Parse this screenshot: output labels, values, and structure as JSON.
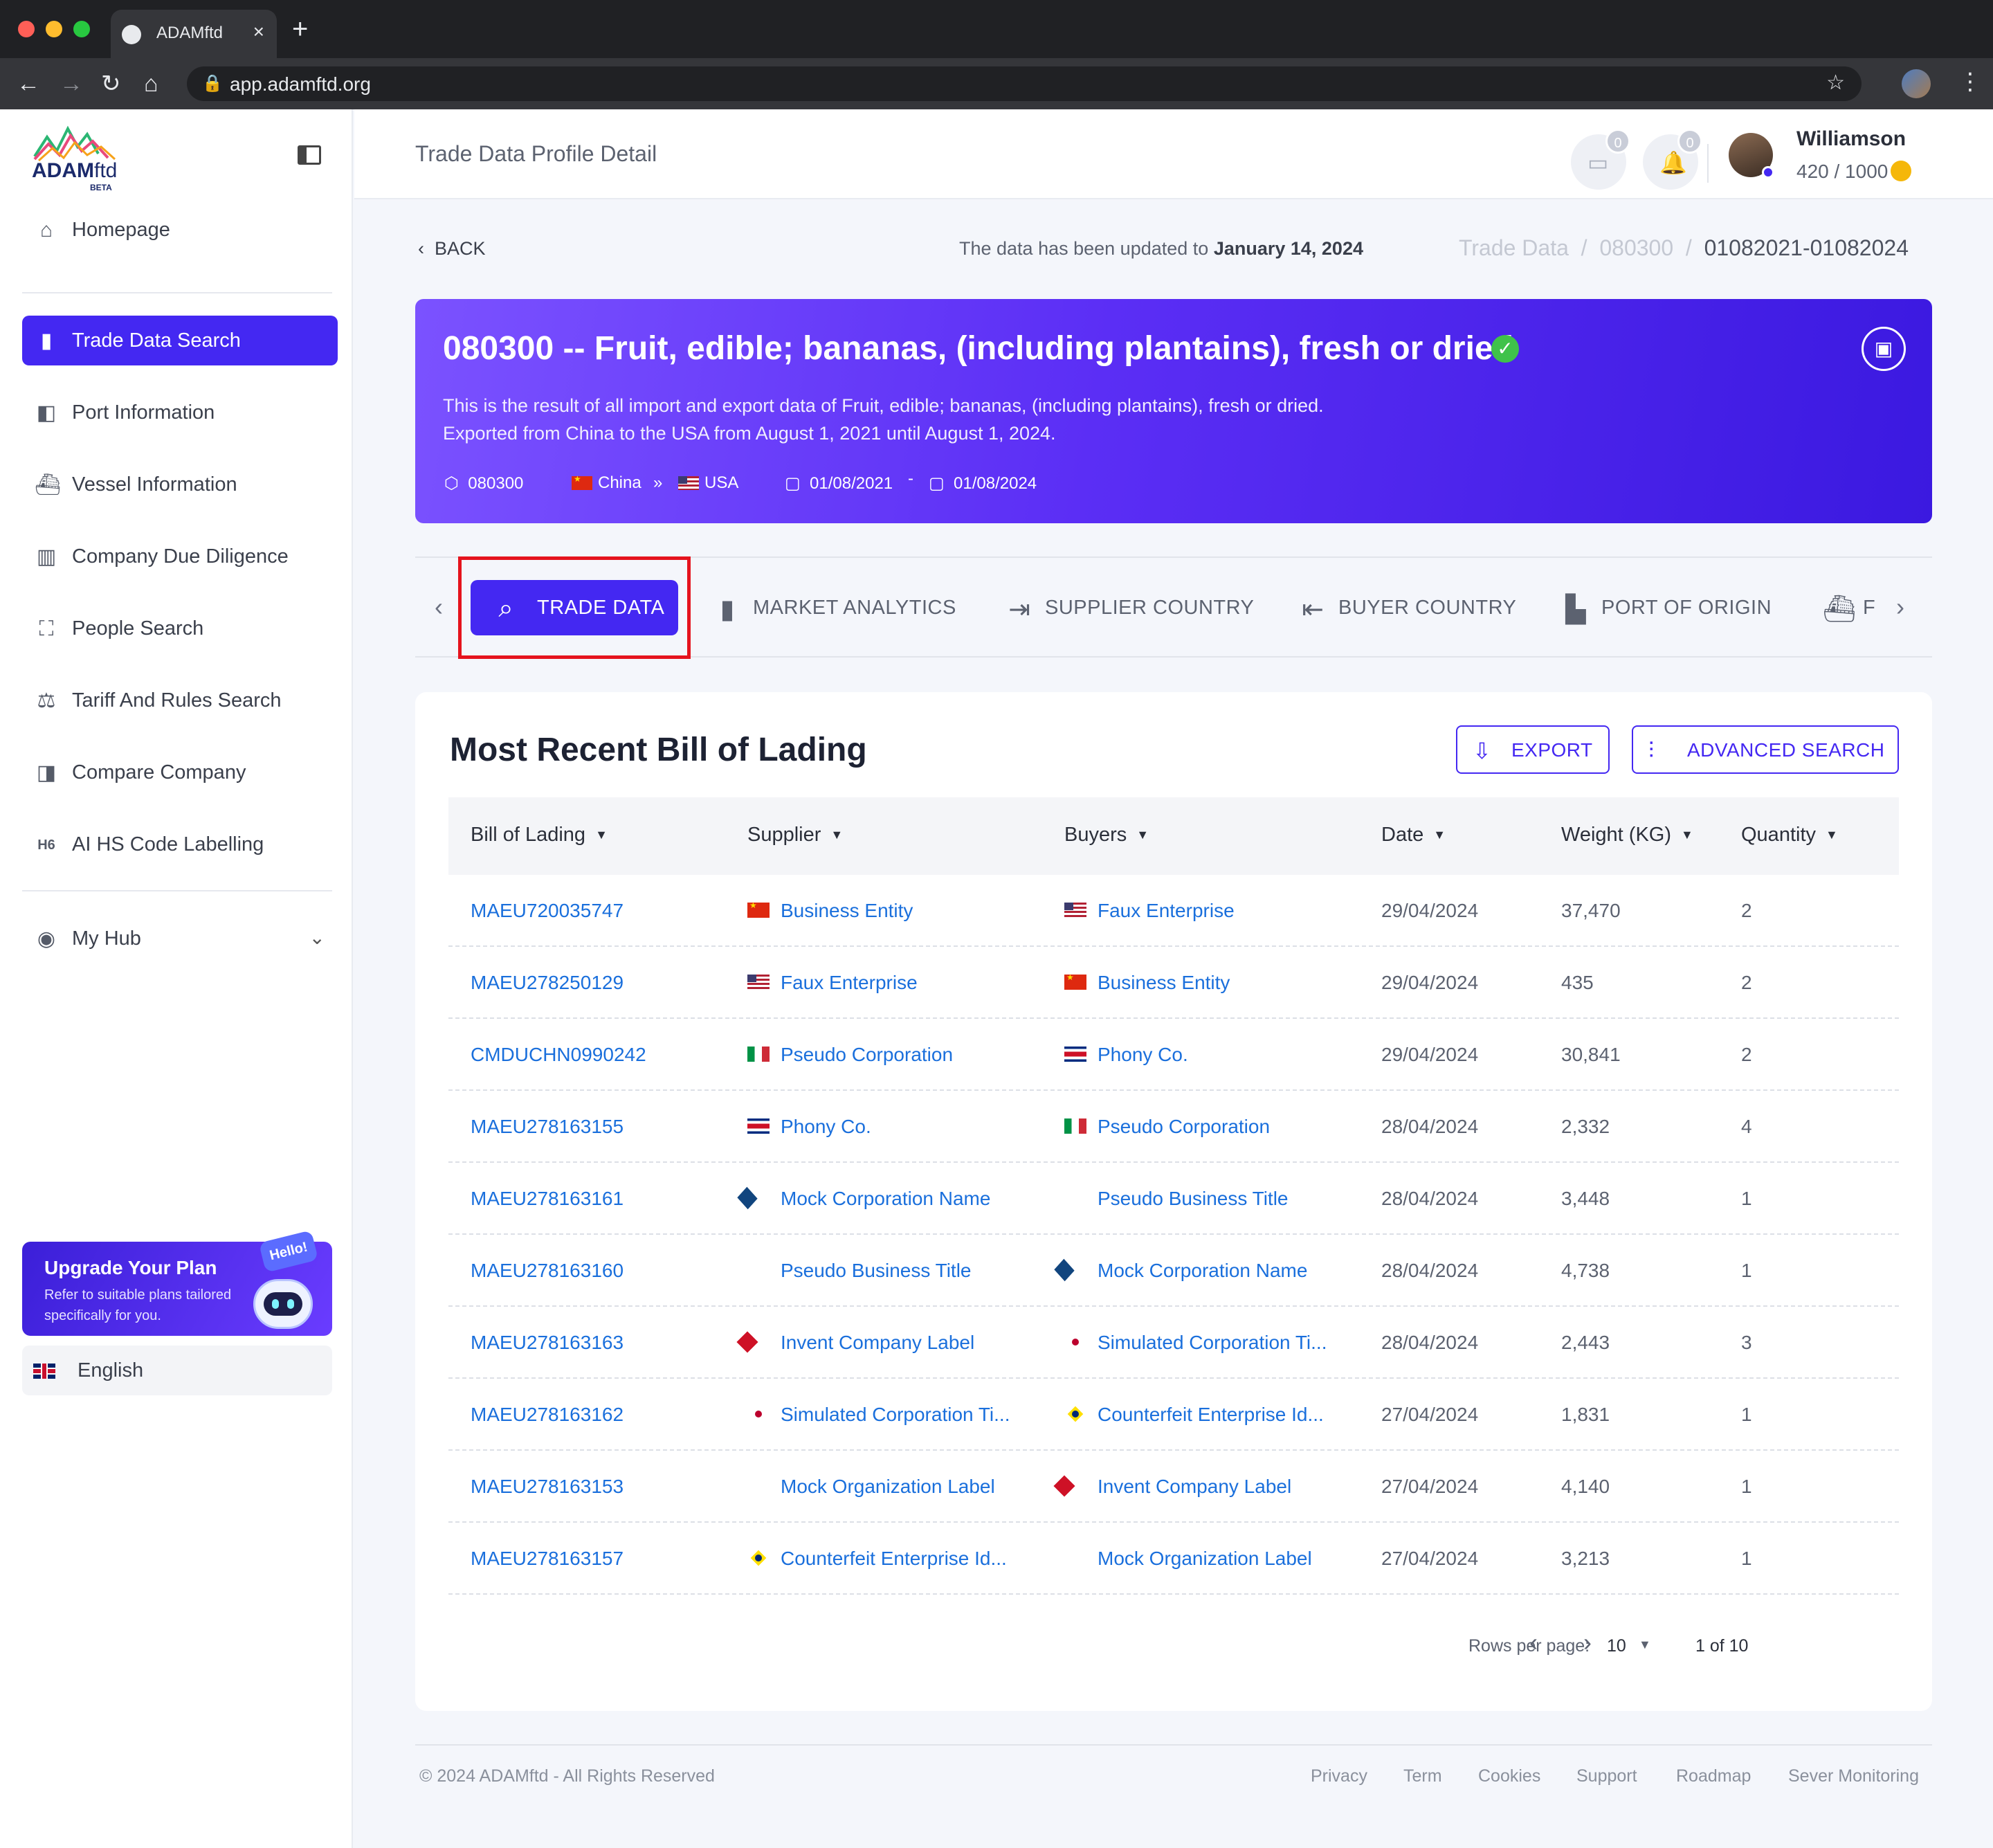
{
  "browser": {
    "tab_title": "ADAMftd",
    "url": "app.adamftd.org"
  },
  "sidebar": {
    "logo_text": "ADAM",
    "logo_suffix": "ftd",
    "logo_badge": "BETA",
    "items": [
      {
        "label": "Homepage",
        "icon": "home-icon"
      },
      {
        "label": "Trade Data Search",
        "icon": "bar-chart-icon",
        "active": true
      },
      {
        "label": "Port Information",
        "icon": "port-icon"
      },
      {
        "label": "Vessel Information",
        "icon": "vessel-icon"
      },
      {
        "label": "Company Due Diligence",
        "icon": "building-icon"
      },
      {
        "label": "People Search",
        "icon": "person-scan-icon"
      },
      {
        "label": "Tariff And Rules Search",
        "icon": "scale-icon"
      },
      {
        "label": "Compare Company",
        "icon": "compare-icon"
      },
      {
        "label": "AI HS Code Labelling",
        "icon": "hs-code-icon"
      }
    ],
    "hub_label": "My Hub",
    "upgrade": {
      "title": "Upgrade Your Plan",
      "subtitle": "Refer to suitable plans tailored specifically for you.",
      "bubble": "Hello!"
    },
    "language": "English"
  },
  "header": {
    "page_title": "Trade Data Profile Detail",
    "messages_count": "0",
    "notifications_count": "0",
    "user_name": "Williamson",
    "credits": "420 / 1000"
  },
  "topbar": {
    "back_label": "BACK",
    "updated_prefix": "The data has been updated to",
    "updated_date": "January 14, 2024",
    "breadcrumb": [
      "Trade Data",
      "080300",
      "01082021-01082024"
    ]
  },
  "hero": {
    "title": "080300 -- Fruit, edible; bananas, (including plantains), fresh or dried",
    "desc_line1": "This is the result of all import and export data of Fruit, edible; bananas, (including plantains), fresh or dried.",
    "desc_line2": "Exported from China to the USA from August 1, 2021 until August 1, 2024.",
    "hs_code": "080300",
    "origin": "China",
    "destination": "USA",
    "date_from": "01/08/2021",
    "date_sep": "-",
    "date_to": "01/08/2024"
  },
  "tabs": [
    {
      "label": "TRADE DATA",
      "icon": "trade-data-icon",
      "active": true
    },
    {
      "label": "MARKET ANALYTICS",
      "icon": "market-analytics-icon"
    },
    {
      "label": "SUPPLIER COUNTRY",
      "icon": "supplier-country-icon"
    },
    {
      "label": "BUYER COUNTRY",
      "icon": "buyer-country-icon"
    },
    {
      "label": "PORT OF ORIGIN",
      "icon": "port-of-origin-icon"
    },
    {
      "label": "F",
      "icon": "ship-icon"
    }
  ],
  "table": {
    "title": "Most Recent Bill of Lading",
    "export_label": "EXPORT",
    "advanced_label": "ADVANCED SEARCH",
    "columns": [
      "Bill of Lading",
      "Supplier",
      "Buyers",
      "Date",
      "Weight (KG)",
      "Quantity"
    ],
    "rows": [
      {
        "bol": "MAEU720035747",
        "supplier": "Business Entity",
        "supplier_flag": "cn",
        "buyer": "Faux Enterprise",
        "buyer_flag": "us",
        "date": "29/04/2024",
        "weight": "37,470",
        "qty": "2"
      },
      {
        "bol": "MAEU278250129",
        "supplier": "Faux Enterprise",
        "supplier_flag": "us",
        "buyer": "Business Entity",
        "buyer_flag": "cn",
        "date": "29/04/2024",
        "weight": "435",
        "qty": "2"
      },
      {
        "bol": "CMDUCHN0990242",
        "supplier": "Pseudo Corporation",
        "supplier_flag": "it",
        "buyer": "Phony Co.",
        "buyer_flag": "cr",
        "date": "29/04/2024",
        "weight": "30,841",
        "qty": "2"
      },
      {
        "bol": "MAEU278163155",
        "supplier": "Phony Co.",
        "supplier_flag": "cr",
        "buyer": "Pseudo Corporation",
        "buyer_flag": "it",
        "date": "28/04/2024",
        "weight": "2,332",
        "qty": "4"
      },
      {
        "bol": "MAEU278163161",
        "supplier": "Mock Corporation Name",
        "supplier_flag": "cz",
        "buyer": "Pseudo Business Title",
        "buyer_flag": "dk",
        "date": "28/04/2024",
        "weight": "3,448",
        "qty": "1"
      },
      {
        "bol": "MAEU278163160",
        "supplier": "Pseudo Business Title",
        "supplier_flag": "dk",
        "buyer": "Mock Corporation Name",
        "buyer_flag": "cz",
        "date": "28/04/2024",
        "weight": "4,738",
        "qty": "1"
      },
      {
        "bol": "MAEU278163163",
        "supplier": "Invent Company Label",
        "supplier_flag": "jo",
        "buyer": "Simulated Corporation Ti...",
        "buyer_flag": "jp",
        "date": "28/04/2024",
        "weight": "2,443",
        "qty": "3"
      },
      {
        "bol": "MAEU278163162",
        "supplier": "Simulated Corporation Ti...",
        "supplier_flag": "jp",
        "buyer": "Counterfeit Enterprise Id...",
        "buyer_flag": "br",
        "date": "27/04/2024",
        "weight": "1,831",
        "qty": "1"
      },
      {
        "bol": "MAEU278163153",
        "supplier": "Mock Organization Label",
        "supplier_flag": "do",
        "buyer": "Invent Company Label",
        "buyer_flag": "jo",
        "date": "27/04/2024",
        "weight": "4,140",
        "qty": "1"
      },
      {
        "bol": "MAEU278163157",
        "supplier": "Counterfeit Enterprise Id...",
        "supplier_flag": "br",
        "buyer": "Mock Organization Label",
        "buyer_flag": "do",
        "date": "27/04/2024",
        "weight": "3,213",
        "qty": "1"
      }
    ],
    "pager": {
      "rows_label": "Rows per page:",
      "rows_value": "10",
      "range": "1 of 10"
    }
  },
  "footer": {
    "copyright": "© 2024 ADAMftd - All Rights Reserved",
    "links": [
      "Privacy",
      "Term",
      "Cookies",
      "Support",
      "Roadmap",
      "Sever Monitoring"
    ]
  },
  "colors": {
    "accent": "#4428f2",
    "link": "#1a6fdc",
    "highlight": "#e5131d"
  }
}
